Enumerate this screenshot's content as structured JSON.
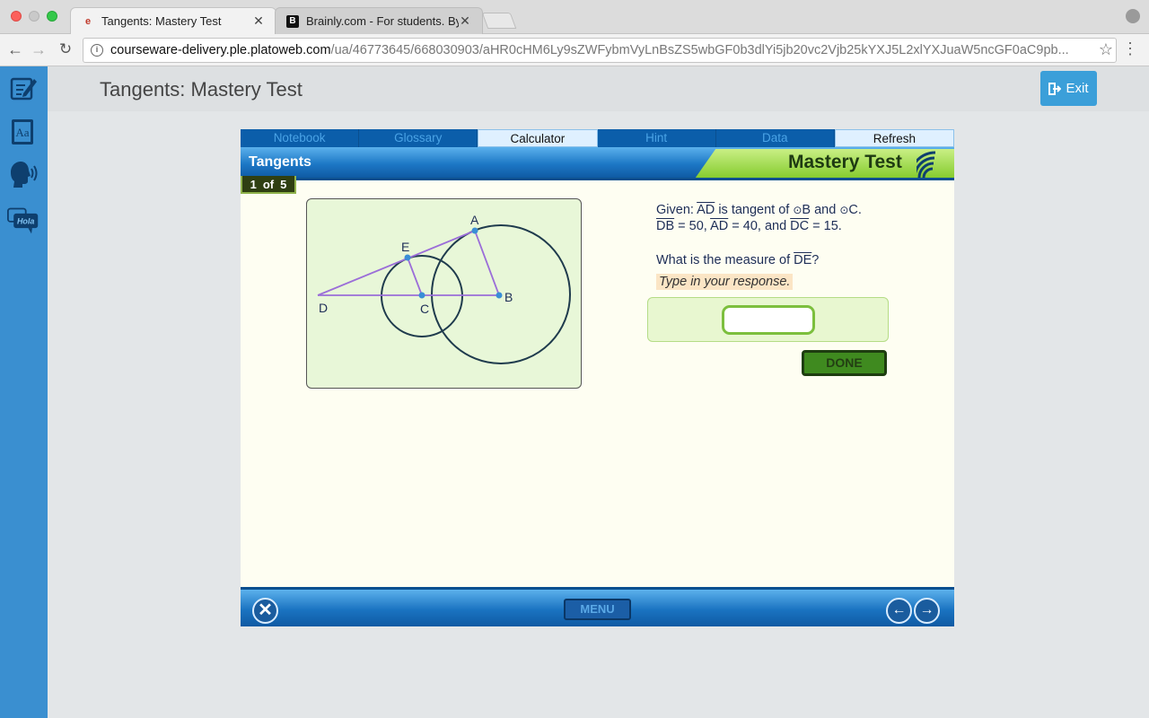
{
  "browser": {
    "tabs": [
      {
        "label": "Tangents: Mastery Test",
        "favicon": "plato-icon",
        "close": "✕"
      },
      {
        "label": "Brainly.com - For students. By",
        "favicon": "brainly-icon",
        "close": "✕"
      }
    ],
    "url_domain": "courseware-delivery.ple.platoweb.com",
    "url_path": "/ua/46773645/668030903/aHR0cHM6Ly9sZWFybmVyLnBsZS5wbGF0b3dlYi5jb20vc2Vjb25kYXJ5L2xlYXJuaW5ncGF0aC9pb..."
  },
  "header": {
    "title": "Tangents: Mastery Test",
    "exit_label": "Exit"
  },
  "sidebar": {
    "hola_label": "Hola",
    "glossary_label": "Aa"
  },
  "lesson": {
    "menu": [
      "Notebook",
      "Glossary",
      "Calculator",
      "Hint",
      "Data",
      "Refresh"
    ],
    "banner_left": "Tangents",
    "banner_right": "Mastery Test",
    "counter": {
      "current": "1",
      "of": "of",
      "total": "5"
    }
  },
  "figure": {
    "labels": {
      "A": "A",
      "B": "B",
      "C": "C",
      "D": "D",
      "E": "E"
    }
  },
  "question": {
    "given_prefix": "Given: ",
    "ad": "AD",
    "tangent_text": " is tangent of ",
    "circle_symbol": "⊙",
    "b": "B",
    "and": " and ",
    "c": "C.",
    "db": "DB",
    "db_val": " = 50, ",
    "ad2": "AD",
    "ad_val": " = 40, and ",
    "dc": "DC",
    "dc_val": " = 15.",
    "prompt_prefix": "What is the measure of ",
    "de": "DE",
    "prompt_suffix": "?",
    "instruction": "Type in your response.",
    "answer_value": ""
  },
  "controls": {
    "done_label": "DONE",
    "menu_label": "MENU",
    "close_symbol": "✕",
    "prev_symbol": "←",
    "next_symbol": "→"
  }
}
